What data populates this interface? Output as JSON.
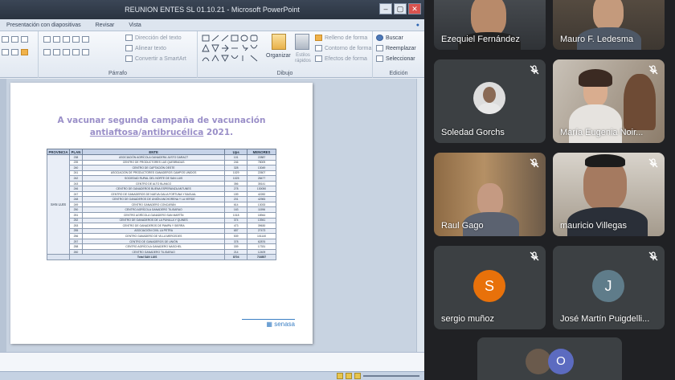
{
  "powerpoint": {
    "window_title": "REUNION ENTES SL 01.10.21 - Microsoft PowerPoint",
    "tabs": [
      "Presentación con diapositivas",
      "Revisar",
      "Vista"
    ],
    "ribbon": {
      "paragraph_label": "Párrafo",
      "drawing_label": "Dibujo",
      "edit_label": "Edición",
      "text_direction": "Dirección del texto",
      "align_text": "Alinear texto",
      "smartart": "Convertir a SmartArt",
      "organize": "Organizar",
      "quick_styles": "Estilos rápidos",
      "shape_fill": "Relleno de forma",
      "shape_outline": "Contorno de forma",
      "shape_effects": "Efectos de forma",
      "search": "Buscar",
      "replace": "Reemplazar",
      "select": "Seleccionar"
    },
    "slide": {
      "title_line1": "A vacunar segunda campaña de vacunación",
      "title_word1": "antiaftosa",
      "title_sep": "/",
      "title_word2": "antibrucélica",
      "title_year": " 2021.",
      "table": {
        "headers": [
          "PROVINCIA",
          "PLAN",
          "ENTE",
          "Ups",
          "MENORES"
        ],
        "province": "SAN LUIS",
        "rows": [
          [
            "238",
            "ASOCIACIÓN AGRÍCOLA GANADERA JUSTO DARACT",
            "101",
            "22887"
          ],
          [
            "239",
            "CENTRO DE PRODUCTORES LAS QUEBRADAS",
            "246",
            "78009"
          ],
          [
            "240",
            "CENTRO DE CAPTACIÓN OESTE",
            "328",
            "13049"
          ],
          [
            "241",
            "ASOCIACIÓN DE PRODUCTORES GANADEROS CAMPOS UNIDOS",
            "1029",
            "22607"
          ],
          [
            "242",
            "SOCIEDAD RURAL DEL NORTE DE SAN LUIS",
            "1025",
            "28477"
          ],
          [
            "243",
            "CENTRO DE ALTO BLANCO",
            "356",
            "35141"
          ],
          [
            "246",
            "CENTRO DE GANADEROS BUENA ESPERANZA ANTUNES",
            "278",
            "130050"
          ],
          [
            "247",
            "CENTRO DE GANADEROS DE NUEVA GALIA FORTUNA Y BAGUAL",
            "159",
            "42282"
          ],
          [
            "248",
            "CENTRO DE GANADEROS DE UNIÓN ANCHORENA Y LA VERDE",
            "201",
            "42983"
          ],
          [
            "249",
            "CENTRO GANADERO CONCARÁN",
            "614",
            "13033"
          ],
          [
            "250",
            "CENTRO AGRÍCOLA GANADERO TILISARAO",
            "163",
            "11596"
          ],
          [
            "251",
            "CENTRO AGRÍCOLA GANADERO SAN MARTÍN",
            "1018",
            "18944"
          ],
          [
            "252",
            "CENTRO DE GANADEROS DE LA PUNILLA Y QUINES",
            "374",
            "13941"
          ],
          [
            "253",
            "CENTRO DE GANADEROS DE PAMPA Y SIERRA",
            "473",
            "39630"
          ],
          [
            "255",
            "ASOCIACIÓN CIVIL LA PETRA",
            "657",
            "27473"
          ],
          [
            "256",
            "CENTRO GANADERO DE VILLA MERCEDES",
            "539",
            "101140"
          ],
          [
            "257",
            "CENTRO DE GANADEROS DE UNIÓN",
            "378",
            "62876"
          ],
          [
            "258",
            "CENTRO AGRÍCOLA GANADERO NASCHEL",
            "339",
            "17331"
          ],
          [
            "260",
            "CENTRO GANADERO TILISARAO",
            "214",
            "12409"
          ]
        ],
        "total_label": "Total SAN LUIS",
        "total_ups": "8704",
        "total_menores": "716857"
      },
      "logo_text": "senasa"
    }
  },
  "participants": [
    {
      "name": "Ezequiel Fernández",
      "muted": false
    },
    {
      "name": "Mauro F. Ledesma",
      "muted": false
    },
    {
      "name": "Soledad Gorchs",
      "muted": true
    },
    {
      "name": "María Eugenia Noir...",
      "muted": true
    },
    {
      "name": "Raul Gago",
      "muted": true
    },
    {
      "name": "mauricio Villegas",
      "muted": true
    },
    {
      "name": "sergio muñoz",
      "muted": true,
      "initial": "S",
      "color": "#e8710a"
    },
    {
      "name": "José Martín Puigdelli...",
      "muted": true,
      "initial": "J",
      "color": "#5f7c8a"
    },
    {
      "name": "",
      "initial": "O",
      "color": "#5c6bc0"
    }
  ],
  "colors": {
    "meet_bg": "#202124",
    "tile_bg": "#3c4043",
    "slide_title": "#9a8fc8"
  }
}
